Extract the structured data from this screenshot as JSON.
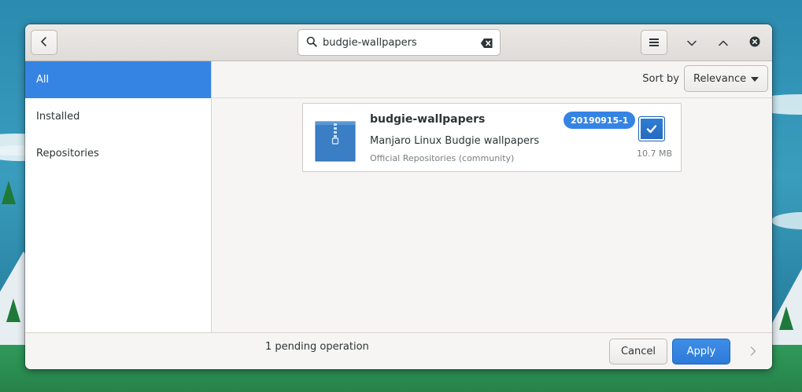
{
  "search": {
    "value": "budgie-wallpapers",
    "placeholder": ""
  },
  "sidebar": {
    "items": [
      {
        "label": "All",
        "selected": true
      },
      {
        "label": "Installed",
        "selected": false
      },
      {
        "label": "Repositories",
        "selected": false
      }
    ]
  },
  "toolbar": {
    "sort_label": "Sort by",
    "sort_value": "Relevance"
  },
  "package": {
    "name": "budgie-wallpapers",
    "description": "Manjaro Linux Budgie wallpapers",
    "repository": "Official Repositories (community)",
    "version": "20190915-1",
    "size": "10.7 MB",
    "selected": true
  },
  "bottombar": {
    "pending": "1 pending operation",
    "cancel_label": "Cancel",
    "apply_label": "Apply"
  },
  "colors": {
    "accent": "#3584e4",
    "headerbar": "#e4e1de",
    "background": "#f6f5f4"
  },
  "icons": {
    "back": "chevron-left-icon",
    "search": "search-icon",
    "clear": "backspace-clear-icon",
    "menu": "hamburger-icon",
    "minimize": "chevron-down-icon",
    "maximize": "chevron-up-icon",
    "close": "close-icon",
    "package": "archive-package-icon",
    "check": "checkmark-icon",
    "next": "chevron-right-icon"
  }
}
